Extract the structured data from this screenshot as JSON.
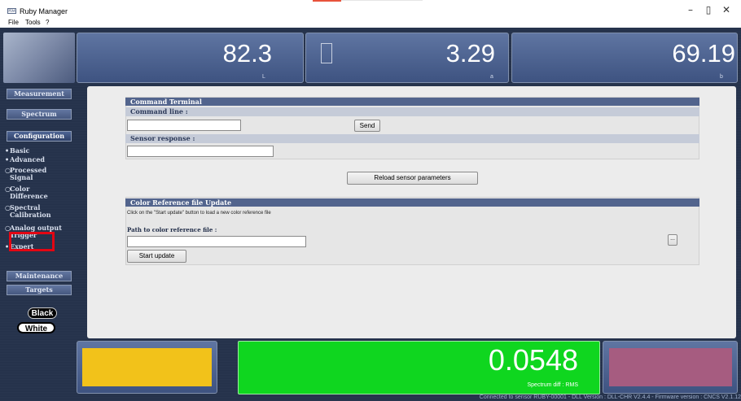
{
  "window": {
    "title": "Ruby Manager",
    "logo_text": "Rм",
    "controls": {
      "minimize": "–",
      "maximize": "▯",
      "close": "✕"
    }
  },
  "menu": [
    "File",
    "Tools",
    "?"
  ],
  "readouts": {
    "L": {
      "value": "82.3",
      "label": "L"
    },
    "a": {
      "value": "3.29",
      "label": "a"
    },
    "b": {
      "value": "69.19",
      "label": "b"
    }
  },
  "nav": {
    "measurement": "Measurement",
    "spectrum": "Spectrum",
    "configuration": "Configuration",
    "config_items": [
      {
        "bullet": "•",
        "label": "Basic"
      },
      {
        "bullet": "•",
        "label": "Advanced"
      },
      {
        "bullet": "○",
        "label": "Processed"
      },
      {
        "bullet": "",
        "label": "Signal"
      },
      {
        "bullet": "○",
        "label": "Color"
      },
      {
        "bullet": "",
        "label": "Difference"
      },
      {
        "bullet": "○",
        "label": "Spectral"
      },
      {
        "bullet": "",
        "label": "Calibration"
      },
      {
        "bullet": "○",
        "label": "Analog output"
      },
      {
        "bullet": "",
        "label": "Trigger"
      },
      {
        "bullet": "•",
        "label": "Expert"
      }
    ],
    "maintenance": "Maintenance",
    "targets": "Targets",
    "black": "Black",
    "white": "White"
  },
  "command_terminal": {
    "title": "Command Terminal",
    "command_line_label": "Command line :",
    "command_value": "",
    "send": "Send",
    "sensor_response_label": "Sensor response :",
    "response_value": "",
    "reload": "Reload sensor parameters"
  },
  "color_reference": {
    "title": "Color Reference file Update",
    "instruction": "Click on the \"Start update\" button to load a new color reference file",
    "path_label": "Path to color reference file :",
    "path_value": "",
    "browse": "...",
    "start_update": "Start update"
  },
  "bottom": {
    "diff_value": "0.0548",
    "diff_label": "Spectrum diff : RMS",
    "swatch_left_color": "#f2c21a",
    "swatch_right_color": "#a65c80",
    "diff_color": "#0fd61f"
  },
  "status": "Connected to sensor RUBY-00001 - DLL Version : DLL-CHR V2.4.4 - Firmware version : CNCS V2.1.12"
}
